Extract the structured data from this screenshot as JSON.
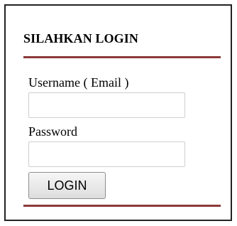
{
  "login_panel": {
    "title": "SILAHKAN LOGIN",
    "username_label": "Username ( Email )",
    "username_value": "",
    "username_placeholder": "",
    "password_label": "Password",
    "password_value": "",
    "password_placeholder": "",
    "login_button_label": "LOGIN"
  },
  "colors": {
    "divider": "#8b3a3a",
    "panel_border": "#222222",
    "background": "#ffffff"
  }
}
